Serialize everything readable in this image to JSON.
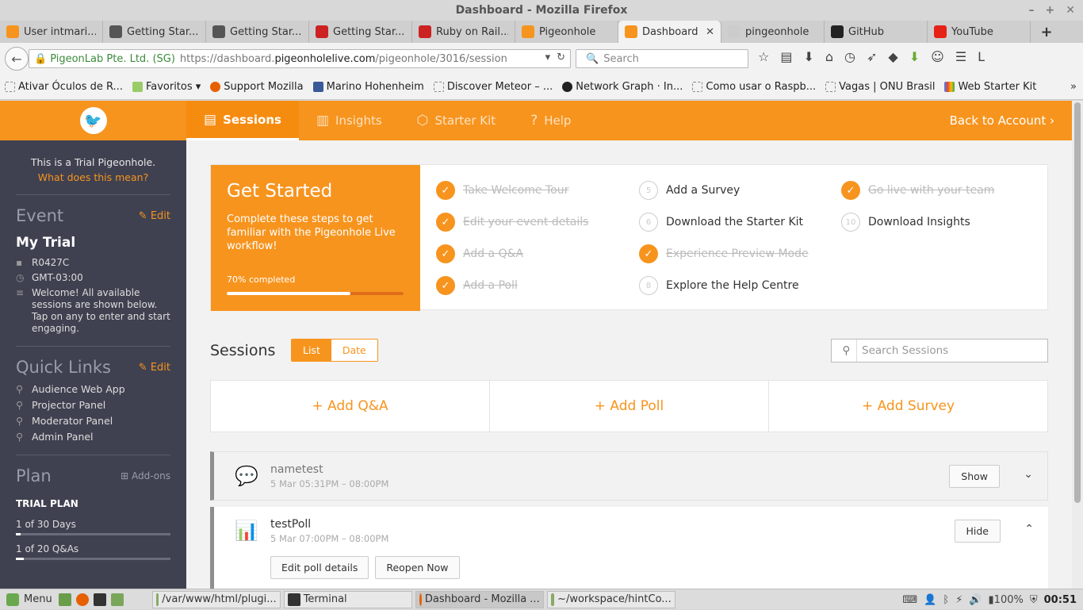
{
  "window": {
    "title": "Dashboard - Mozilla Firefox"
  },
  "tabs": [
    {
      "label": "User intmari...",
      "color": "#f7941e"
    },
    {
      "label": "Getting Star...",
      "color": "#555555"
    },
    {
      "label": "Getting Star...",
      "color": "#555555"
    },
    {
      "label": "Getting Star...",
      "color": "#cc2222"
    },
    {
      "label": "Ruby on Rail...",
      "color": "#cc2222"
    },
    {
      "label": "Pigeonhole",
      "color": "#f7941e"
    },
    {
      "label": "Dashboard",
      "color": "#f7941e",
      "active": true
    },
    {
      "label": "pingeonhole",
      "color": "#cccccc"
    },
    {
      "label": "GitHub",
      "color": "#222222"
    },
    {
      "label": "YouTube",
      "color": "#e62117"
    }
  ],
  "nav": {
    "org": "PigeonLab Pte. Ltd. (SG)",
    "url_prefix": "https://dashboard.",
    "url_domain": "pigeonholelive.com",
    "url_path": "/pigeonhole/3016/session",
    "search_placeholder": "Search"
  },
  "bookmarks": [
    {
      "label": "Ativar Óculos de R..."
    },
    {
      "label": "Favoritos ▾"
    },
    {
      "label": "Support Mozilla"
    },
    {
      "label": "Marino Hohenheim"
    },
    {
      "label": "Discover Meteor – ..."
    },
    {
      "label": "Network Graph · In..."
    },
    {
      "label": "Como usar o Raspb..."
    },
    {
      "label": "Vagas | ONU Brasil"
    },
    {
      "label": "Web Starter Kit"
    }
  ],
  "sidebar": {
    "trial_text": "This is a Trial Pigeonhole.",
    "trial_link": "What does this mean?",
    "event_heading": "Event",
    "edit_label": "Edit",
    "event_name": "My Trial",
    "event_code": "R0427C",
    "timezone": "GMT-03:00",
    "welcome": "Welcome! All available sessions are shown below. Tap on any to enter and start engaging.",
    "quicklinks_heading": "Quick Links",
    "quicklinks": [
      "Audience Web App",
      "Projector Panel",
      "Moderator Panel",
      "Admin Panel"
    ],
    "plan_heading": "Plan",
    "addons_label": "Add-ons",
    "plan_name": "TRIAL PLAN",
    "plan_days": "1 of 30 Days",
    "plan_days_fraction": 0.033,
    "plan_qas": "1 of 20 Q&As",
    "plan_qas_fraction": 0.05
  },
  "topnav": {
    "items": [
      "Sessions",
      "Insights",
      "Starter Kit",
      "Help"
    ],
    "back": "Back to Account"
  },
  "get_started": {
    "title": "Get Started",
    "desc": "Complete these steps to get familiar with the Pigeonhole Live workflow!",
    "progress_label": "70% completed",
    "progress": 0.7,
    "steps": [
      {
        "label": "Take Welcome Tour",
        "done": true,
        "num": "1"
      },
      {
        "label": "Edit your event details",
        "done": true,
        "num": "2"
      },
      {
        "label": "Add a Q&A",
        "done": true,
        "num": "3"
      },
      {
        "label": "Add a Poll",
        "done": true,
        "num": "4"
      },
      {
        "label": "Add a Survey",
        "done": false,
        "num": "5"
      },
      {
        "label": "Download the Starter Kit",
        "done": false,
        "num": "6"
      },
      {
        "label": "Experience Preview Mode",
        "done": true,
        "num": "7"
      },
      {
        "label": "Explore the Help Centre",
        "done": false,
        "num": "8"
      },
      {
        "label": "Go live with your team",
        "done": true,
        "num": "9"
      },
      {
        "label": "Download Insights",
        "done": false,
        "num": "10"
      }
    ]
  },
  "sessions": {
    "heading": "Sessions",
    "view_list": "List",
    "view_date": "Date",
    "search_placeholder": "Search Sessions",
    "add_qa": "+ Add Q&A",
    "add_poll": "+ Add Poll",
    "add_survey": "+ Add Survey",
    "items": [
      {
        "name": "nametest",
        "time": "5 Mar 05:31PM – 08:00PM",
        "button": "Show"
      },
      {
        "name": "testPoll",
        "time": "5 Mar 07:00PM – 08:00PM",
        "button": "Hide",
        "edit": "Edit poll details",
        "reopen": "Reopen Now"
      }
    ]
  },
  "taskbar": {
    "menu": "Menu",
    "tasks": [
      "/var/www/html/plugi...",
      "Terminal",
      "Dashboard - Mozilla ...",
      "~/workspace/hintCo..."
    ],
    "battery": "100%",
    "time": "00:51"
  }
}
